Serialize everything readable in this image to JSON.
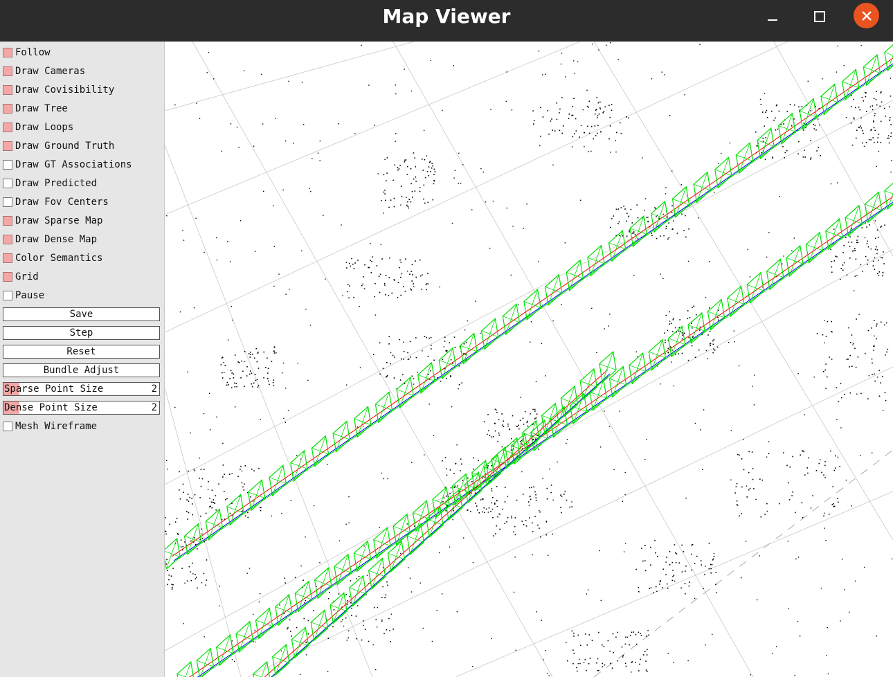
{
  "window": {
    "title": "Map Viewer"
  },
  "titlebar_icons": {
    "minimize": "minimize-icon",
    "maximize": "maximize-icon",
    "close": "close-icon"
  },
  "colors": {
    "checked": "#f4a7a7",
    "close_button": "#e95420",
    "trajectory_frames": "#00e000",
    "ground_truth_line": "#ff0000",
    "predicted_line": "#0000ff",
    "grid": "#c8c8c8",
    "points": "#000000"
  },
  "panel": {
    "checkboxes": [
      {
        "label": "Follow",
        "checked": true
      },
      {
        "label": "Draw Cameras",
        "checked": true
      },
      {
        "label": "Draw Covisibility",
        "checked": true
      },
      {
        "label": "Draw Tree",
        "checked": true
      },
      {
        "label": "Draw Loops",
        "checked": true
      },
      {
        "label": "Draw Ground Truth",
        "checked": true
      },
      {
        "label": "Draw GT Associations",
        "checked": false
      },
      {
        "label": "Draw Predicted",
        "checked": false
      },
      {
        "label": "Draw Fov Centers",
        "checked": false
      },
      {
        "label": "Draw Sparse Map",
        "checked": true
      },
      {
        "label": "Draw Dense Map",
        "checked": true
      },
      {
        "label": "Color Semantics",
        "checked": true
      },
      {
        "label": "Grid",
        "checked": true
      },
      {
        "label": "Pause",
        "checked": false
      }
    ],
    "buttons": {
      "save": "Save",
      "step": "Step",
      "reset": "Reset",
      "bundle_adjust": "Bundle Adjust"
    },
    "sliders": [
      {
        "label": "Sparse Point Size",
        "value": "2",
        "fraction": 0.1
      },
      {
        "label": "Dense Point Size",
        "value": "2",
        "fraction": 0.1
      }
    ],
    "mesh_wireframe": {
      "label": "Mesh Wireframe",
      "checked": false
    }
  }
}
